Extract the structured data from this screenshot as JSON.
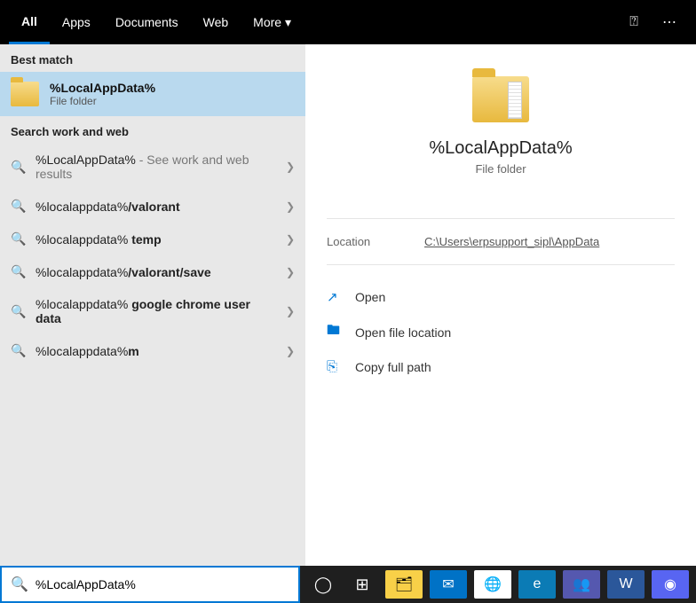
{
  "tabs": {
    "all": "All",
    "apps": "Apps",
    "documents": "Documents",
    "web": "Web",
    "more": "More"
  },
  "sections": {
    "best": "Best match",
    "search_web": "Search work and web"
  },
  "best_match": {
    "title": "%LocalAppData%",
    "subtitle": "File folder"
  },
  "items": [
    {
      "text": "%LocalAppData%",
      "suffix": " - See work and web results"
    },
    {
      "prefix": "%localappdata%",
      "bold": "/valorant"
    },
    {
      "prefix": "%localappdata% ",
      "bold": "temp"
    },
    {
      "prefix": "%localappdata%",
      "bold": "/valorant/save"
    },
    {
      "prefix": "%localappdata% ",
      "bold": "google chrome user data"
    },
    {
      "prefix": "%localappdata%",
      "bold": "m"
    }
  ],
  "preview": {
    "title": "%LocalAppData%",
    "subtitle": "File folder",
    "loc_label": "Location",
    "loc_path": "C:\\Users\\erpsupport_sipl\\AppData"
  },
  "actions": {
    "open": "Open",
    "open_loc": "Open file location",
    "copy": "Copy full path"
  },
  "search": {
    "value": "%LocalAppData%"
  }
}
